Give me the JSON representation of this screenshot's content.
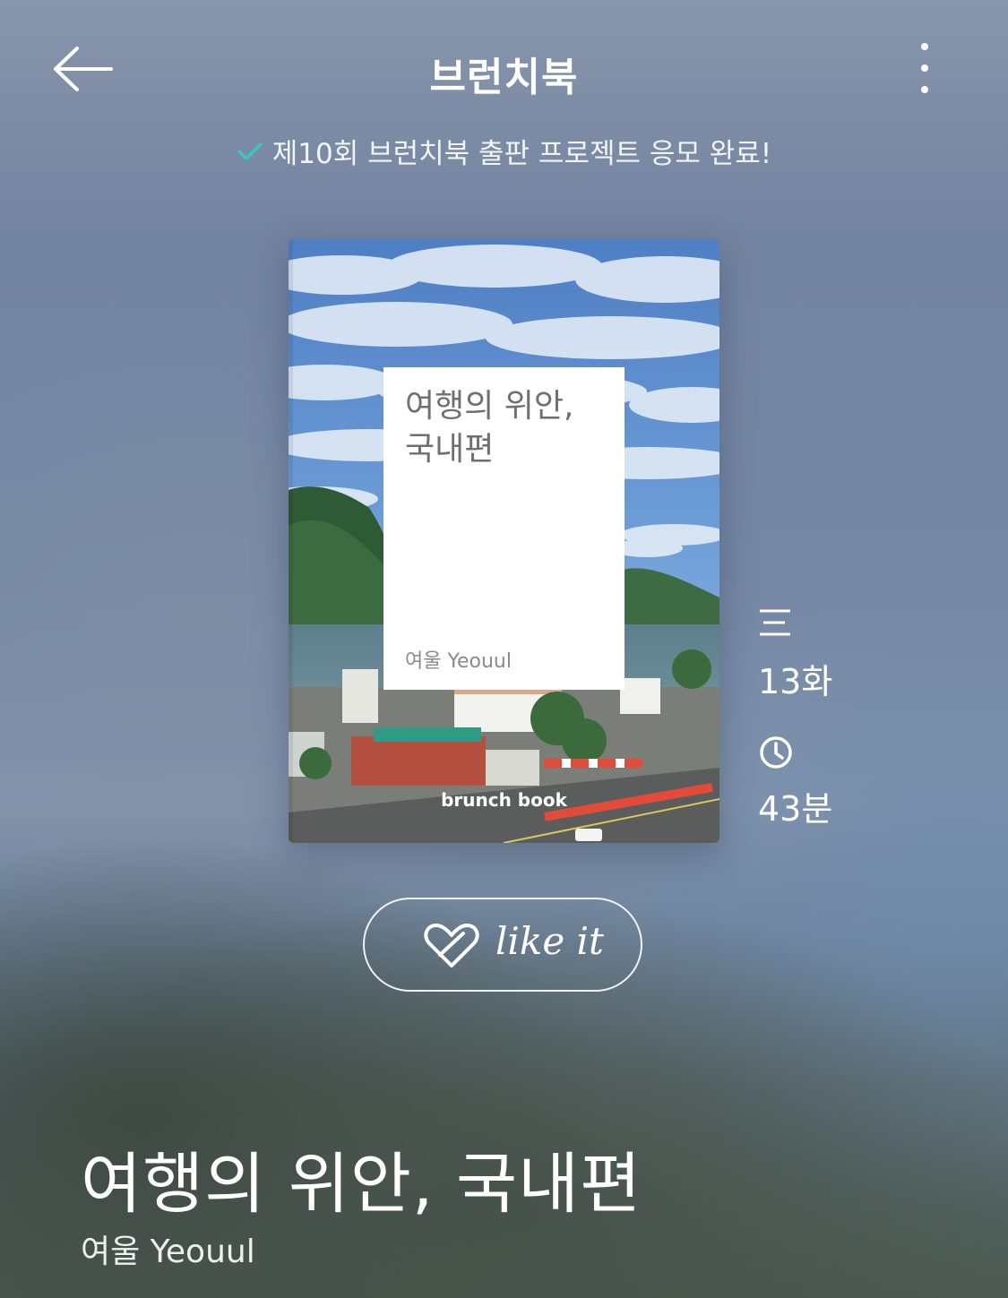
{
  "header": {
    "title": "브런치북",
    "back_icon": "arrow-left-icon",
    "more_icon": "more-vertical-icon"
  },
  "notice": {
    "icon": "check-icon",
    "text": "제10회 브런치북 출판 프로젝트 응모 완료!",
    "icon_color": "#39c5c5"
  },
  "cover": {
    "title": "여행의 위안, 국내편",
    "author": "여울 Yeouul",
    "brand": "brunch book"
  },
  "stats": {
    "episodes": {
      "icon": "list-icon",
      "value": "13화"
    },
    "time": {
      "icon": "clock-icon",
      "value": "43분"
    }
  },
  "like": {
    "icon": "heart-icon",
    "label": "like it"
  },
  "book": {
    "title": "여행의 위안, 국내편",
    "author": "여울 Yeouul"
  }
}
